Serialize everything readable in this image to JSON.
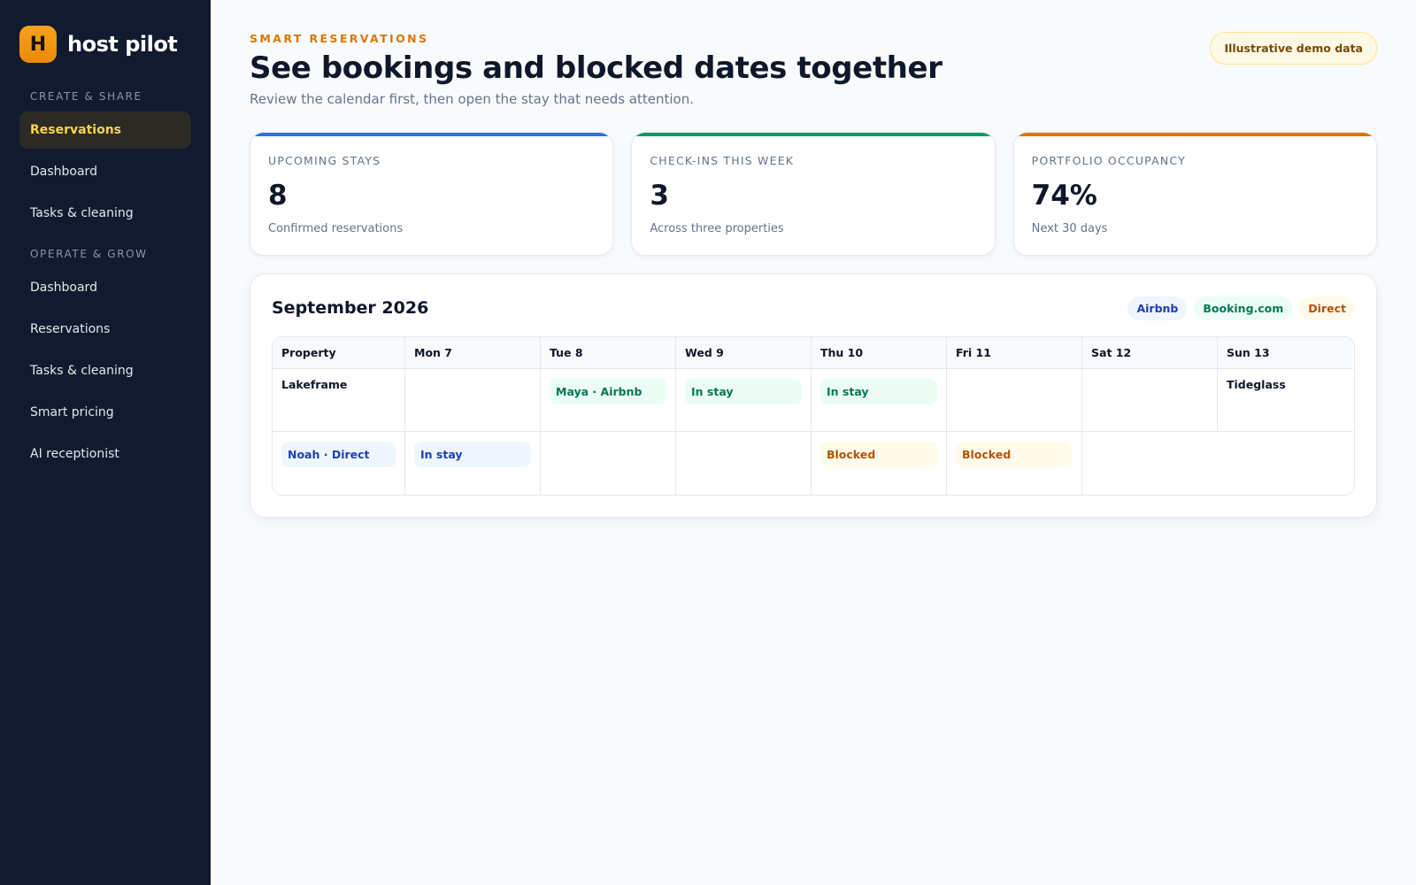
{
  "brand": {
    "logo_letter": "H",
    "name": "host pilot"
  },
  "sidebar": {
    "sections": [
      {
        "heading": "CREATE & SHARE",
        "items": [
          "Reservations",
          "Dashboard",
          "Tasks & cleaning"
        ]
      },
      {
        "heading": "OPERATE & GROW",
        "items": [
          "Dashboard",
          "Reservations",
          "Tasks & cleaning",
          "Smart pricing",
          "AI receptionist"
        ]
      }
    ],
    "active_item": "Reservations"
  },
  "header": {
    "eyebrow": "SMART RESERVATIONS",
    "title": "See bookings and blocked dates together",
    "subtitle": "Review the calendar first, then open the stay that needs attention.",
    "badge": "Illustrative demo data"
  },
  "stats": [
    {
      "label": "UPCOMING STAYS",
      "value": "8",
      "caption": "Confirmed reservations",
      "accent": "#2f6fd6"
    },
    {
      "label": "CHECK-INS THIS WEEK",
      "value": "3",
      "caption": "Across three properties",
      "accent": "#0f9a64"
    },
    {
      "label": "PORTFOLIO OCCUPANCY",
      "value": "74%",
      "caption": "Next 30 days",
      "accent": "#d97706"
    }
  ],
  "calendar": {
    "title": "September 2026",
    "legend": [
      "Airbnb",
      "Booking.com",
      "Direct"
    ],
    "columns": [
      "Property",
      "Mon 7",
      "Tue 8",
      "Wed 9",
      "Thu 10",
      "Fri 11",
      "Sat 12",
      "Sun 13"
    ],
    "row1": {
      "property": "Lakeframe",
      "tue": "Maya · Airbnb",
      "wed": "In stay",
      "thu": "In stay",
      "sun": "Tideglass"
    },
    "row2": {
      "property_pill": "Noah · Direct",
      "mon": "In stay",
      "thu": "Blocked",
      "fri": "Blocked"
    }
  },
  "colors": {
    "sidebar_bg": "#111a2e",
    "accent": "#f59e0b",
    "airbnb": "#1e40af",
    "booking": "#047857",
    "direct": "#b45309"
  }
}
